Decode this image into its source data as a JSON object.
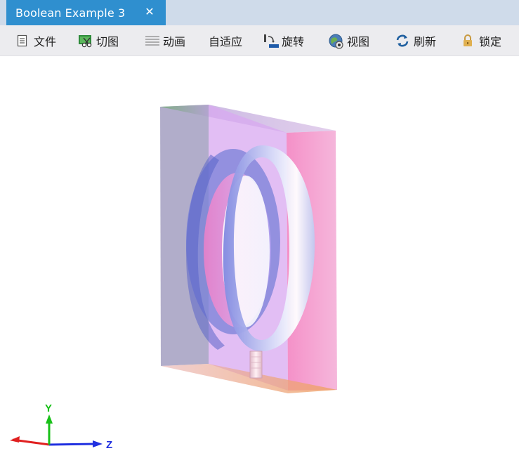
{
  "tab": {
    "title": "Boolean Example 3",
    "close_glyph": "✕"
  },
  "toolbar": {
    "items": [
      {
        "label": "文件",
        "icon": "document-icon"
      },
      {
        "label": "切图",
        "icon": "scissors-icon"
      },
      {
        "label": "动画",
        "icon": "animation-icon"
      },
      {
        "label": "自适应",
        "icon": ""
      },
      {
        "label": "旋转",
        "icon": "rotate-icon"
      },
      {
        "label": "视图",
        "icon": "view-globe-icon"
      },
      {
        "label": "刷新",
        "icon": "refresh-icon"
      },
      {
        "label": "锁定",
        "icon": "lock-icon"
      }
    ]
  },
  "axes": {
    "y_label": "Y",
    "z_label": "Z",
    "x_color": "#e02020",
    "y_color": "#18c018",
    "z_color": "#2030e0"
  },
  "colors": {
    "tab_active": "#2f8fcf",
    "tabbar_bg": "#cfdbea",
    "toolbar_bg": "#ececef"
  }
}
